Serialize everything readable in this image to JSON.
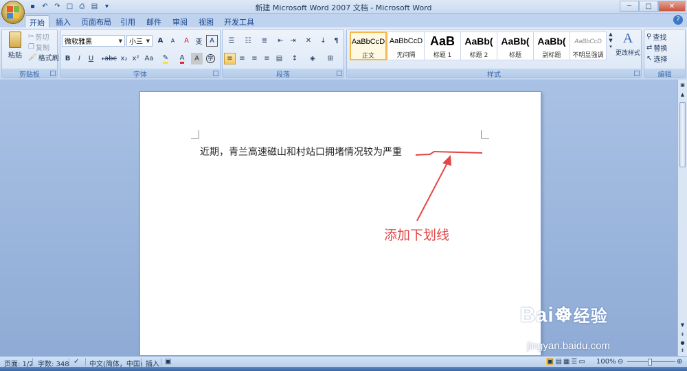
{
  "window": {
    "title": "新建 Microsoft Word 2007 文档 - Microsoft Word"
  },
  "tabs": [
    "开始",
    "插入",
    "页面布局",
    "引用",
    "邮件",
    "审阅",
    "视图",
    "开发工具"
  ],
  "ribbon": {
    "clipboard": {
      "paste": "粘贴",
      "cut": "剪切",
      "copy": "复制",
      "format_painter": "格式刷",
      "label": "剪贴板"
    },
    "font": {
      "font_name": "微软雅黑",
      "font_size": "小三",
      "bold": "B",
      "italic": "I",
      "underline": "U",
      "strike": "abc",
      "subscript": "x₂",
      "superscript": "x²",
      "change_case": "Aa",
      "grow": "A",
      "shrink": "A",
      "clear": "A",
      "phonetic": "变",
      "border": "A",
      "shade": "A",
      "enclose": "字",
      "label": "字体",
      "highlight_color": "#f5e33c",
      "font_color": "#e0242e"
    },
    "paragraph": {
      "label": "段落"
    },
    "styles": {
      "label": "样式",
      "items": [
        {
          "sample": "AaBbCcD",
          "name": "正文"
        },
        {
          "sample": "AaBbCcD",
          "name": "无间隔"
        },
        {
          "sample": "AaB",
          "name": "标题 1"
        },
        {
          "sample": "AaBb(",
          "name": "标题 2"
        },
        {
          "sample": "AaBb(",
          "name": "标题"
        },
        {
          "sample": "AaBb(",
          "name": "副标题"
        },
        {
          "sample": "AaBbCcD",
          "name": "不明显强调"
        }
      ],
      "change_styles": "更改样式"
    },
    "editing": {
      "find": "查找",
      "replace": "替换",
      "select": "选择",
      "label": "编辑"
    }
  },
  "document": {
    "text": "近期，青兰高速磁山和村站口拥堵情况较为严重",
    "annotation": "添加下划线",
    "annotation_color": "#e34747"
  },
  "statusbar": {
    "page": "页面: 1/2",
    "words": "字数: 348",
    "language": "中文(简体，中国)",
    "mode": "插入",
    "zoom": "100%"
  },
  "watermark": {
    "brand": "Bai",
    "brand2": "经验",
    "url": "jingyan.baidu.com"
  }
}
